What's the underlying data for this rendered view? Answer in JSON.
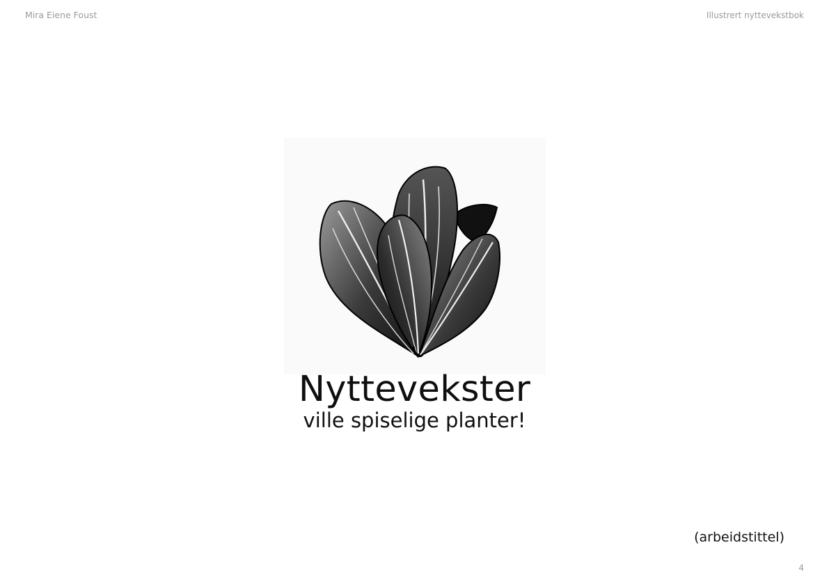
{
  "header": {
    "author": "Mira Eiene Foust",
    "book_title": "Illustrert nyttevekstbok"
  },
  "cover": {
    "illustration_icon": "plantain-leaves-illustration",
    "title": "Nyttevekster",
    "subtitle": "ville spiselige planter!",
    "note": "(arbeidstittel)"
  },
  "footer": {
    "page_number": "4"
  },
  "colors": {
    "text": "#111111",
    "header_text": "#9a9a9a",
    "background": "#ffffff"
  }
}
